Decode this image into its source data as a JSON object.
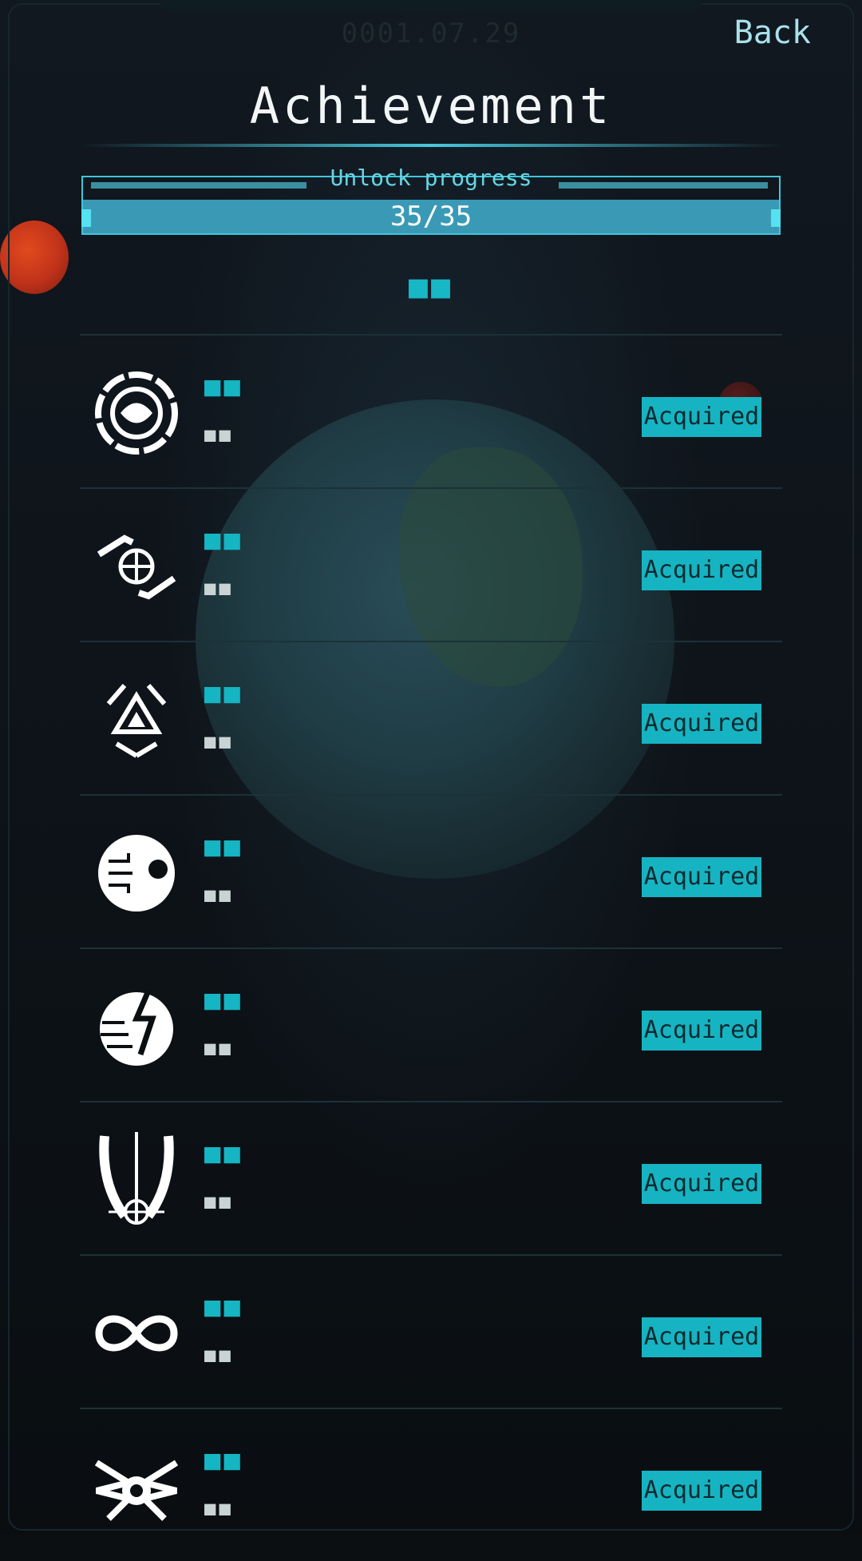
{
  "header": {
    "date": "0001.07.29",
    "back_label": "Back",
    "title": "Achievement"
  },
  "progress": {
    "label": "Unlock progress",
    "value_text": "35/35",
    "fraction": 1.0
  },
  "section_badge": "■■",
  "achievements": [
    {
      "icon": "globe-emblem-icon",
      "name": "■■",
      "desc": "■■",
      "status": "Acquired"
    },
    {
      "icon": "hands-globe-icon",
      "name": "■■",
      "desc": "■■",
      "status": "Acquired"
    },
    {
      "icon": "triangle-hands-icon",
      "name": "■■",
      "desc": "■■",
      "status": "Acquired"
    },
    {
      "icon": "circuit-eye-icon",
      "name": "■■",
      "desc": "■■",
      "status": "Acquired"
    },
    {
      "icon": "lightning-planet-icon",
      "name": "■■",
      "desc": "■■",
      "status": "Acquired"
    },
    {
      "icon": "winged-globe-icon",
      "name": "■■",
      "desc": "■■",
      "status": "Acquired"
    },
    {
      "icon": "infinity-icon",
      "name": "■■",
      "desc": "■■",
      "status": "Acquired"
    },
    {
      "icon": "winged-crest-icon",
      "name": "■■",
      "desc": "■■",
      "status": "Acquired"
    }
  ],
  "colors": {
    "accent": "#16b4c2",
    "progress_fill": "#3a9ab6",
    "back_text": "#a8e2ec"
  }
}
